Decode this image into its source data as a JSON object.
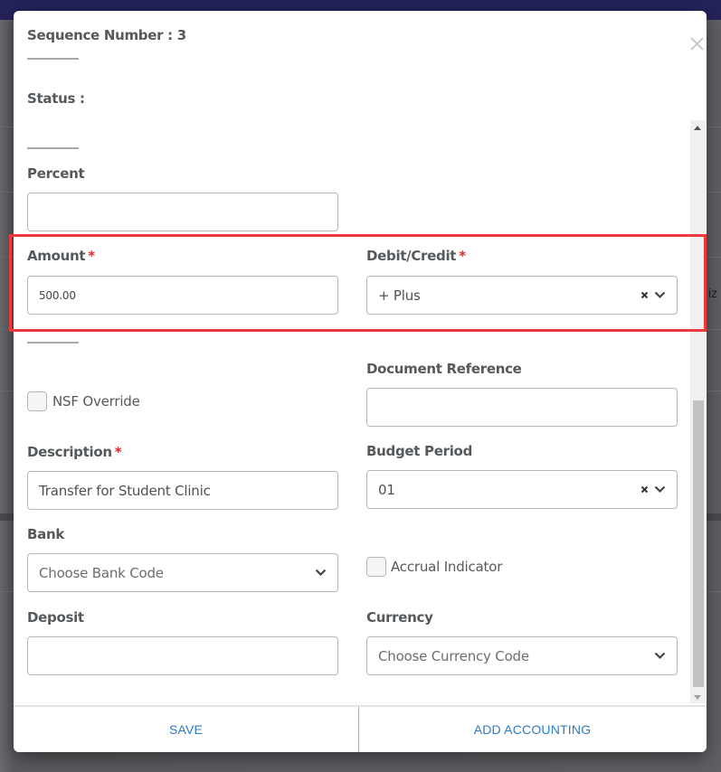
{
  "modal": {
    "sequence_label": "Sequence Number : 3",
    "status_label": "Status :",
    "close_icon": "close-icon"
  },
  "fields": {
    "percent": {
      "label": "Percent",
      "value": ""
    },
    "amount": {
      "label": "Amount",
      "required": "*",
      "value": "500.00"
    },
    "debit_credit": {
      "label": "Debit/Credit",
      "required": "*",
      "value": "+ Plus",
      "clear_icon": "×"
    },
    "document_reference": {
      "label": "Document Reference",
      "value": ""
    },
    "nsf_override": {
      "label": "NSF Override",
      "checked": false
    },
    "description": {
      "label": "Description",
      "required": "*",
      "value": "Transfer for Student Clinic"
    },
    "budget_period": {
      "label": "Budget Period",
      "value": "01",
      "clear_icon": "×"
    },
    "bank": {
      "label": "Bank",
      "placeholder": "Choose Bank Code"
    },
    "accrual_indicator": {
      "label": "Accrual Indicator",
      "checked": false
    },
    "deposit": {
      "label": "Deposit",
      "value": ""
    },
    "currency": {
      "label": "Currency",
      "placeholder": "Choose Currency Code"
    }
  },
  "footer": {
    "save_label": "SAVE",
    "add_accounting_label": "ADD ACCOUNTING"
  },
  "background": {
    "partial_text": "iz"
  },
  "colors": {
    "accent": "#2f7bbf",
    "required": "#e3262b",
    "highlight": "#ea3a3d"
  }
}
